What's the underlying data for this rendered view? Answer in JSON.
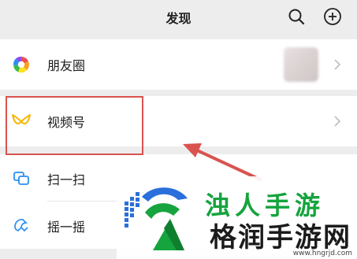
{
  "header": {
    "title": "发现",
    "search_icon": "search-icon",
    "add_icon": "plus-circle-icon"
  },
  "menu": {
    "items": [
      {
        "label": "朋友圈",
        "icon": "moments-icon"
      },
      {
        "label": "视频号",
        "icon": "channels-icon"
      },
      {
        "label": "扫一扫",
        "icon": "scan-icon"
      },
      {
        "label": "摇一摇",
        "icon": "shake-icon"
      }
    ]
  },
  "annotation": {
    "box_color": "#d9534f",
    "arrow_color": "#d9534f"
  },
  "watermark": {
    "brand_green": "浊人手游",
    "brand_black": "格润手游网",
    "url": "www.hngrjd.com",
    "green_color": "#15a43d",
    "blue_color": "#2a6fdb"
  }
}
